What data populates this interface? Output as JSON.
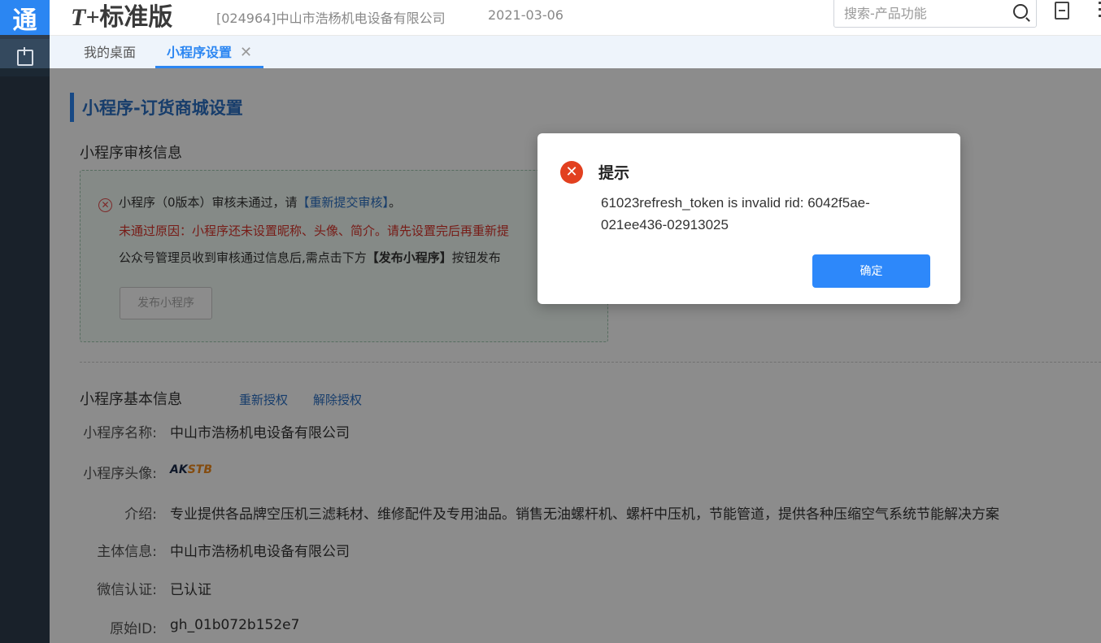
{
  "rail": {
    "logo": "通"
  },
  "header": {
    "brand_t": "T+",
    "brand_name": "标准版",
    "company": "[024964]中山市浩杨机电设备有限公司",
    "date": "2021-03-06",
    "search_placeholder": "搜索-产品功能"
  },
  "tabs": [
    {
      "label": "我的桌面",
      "active": false
    },
    {
      "label": "小程序设置",
      "active": true,
      "close": "✕"
    }
  ],
  "page": {
    "title": "小程序-订货商城设置",
    "audit": {
      "heading": "小程序审核信息",
      "line1_prefix": "小程序（0版本）审核未通过，请",
      "line1_link": "【重新提交审核】",
      "line1_suffix": "。",
      "line2": "未通过原因：小程序还未设置昵称、头像、简介。请先设置完后再重新提",
      "line3_prefix": "公众号管理员收到审核通过信息后,需点击下方",
      "line3_bold": "【发布小程序】",
      "line3_suffix": "按钮发布",
      "publish_button": "发布小程序"
    },
    "basic": {
      "heading": "小程序基本信息",
      "reauth_link": "重新授权",
      "unauth_link": "解除授权",
      "rows": [
        {
          "label": "小程序名称:",
          "value": "中山市浩杨机电设备有限公司"
        },
        {
          "label": "小程序头像:",
          "value": ""
        },
        {
          "label": "介绍:",
          "value": "专业提供各品牌空压机三滤耗材、维修配件及专用油品。销售无油螺杆机、螺杆中压机，节能管道，提供各种压缩空气系统节能解决方案"
        },
        {
          "label": "主体信息:",
          "value": "中山市浩杨机电设备有限公司"
        },
        {
          "label": "微信认证:",
          "value": "已认证"
        },
        {
          "label": "原始ID:",
          "value": "gh_01b072b152e7"
        }
      ],
      "avatar_text": "AK",
      "avatar_text2": "STB"
    }
  },
  "dialog": {
    "title": "提示",
    "message": "61023refresh_token is invalid rid: 6042f5ae-021ee436-02913025",
    "ok_label": "确定"
  }
}
